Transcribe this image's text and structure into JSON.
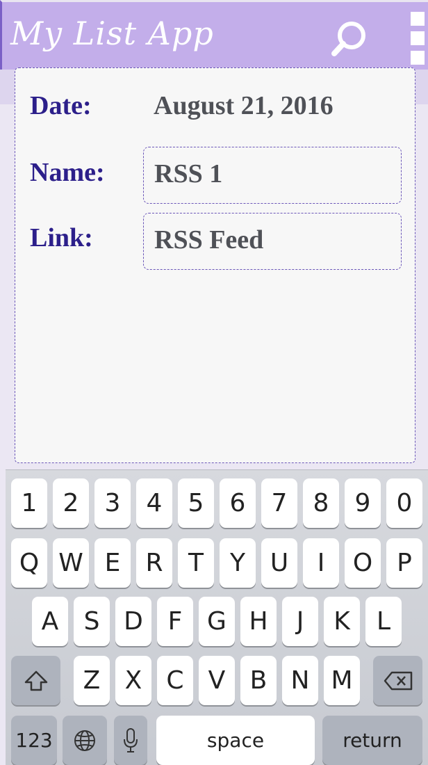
{
  "app": {
    "title": "My List App"
  },
  "form": {
    "date_label": "Date:",
    "date_value": "August 21, 2016",
    "name_label": "Name:",
    "name_value": "RSS 1",
    "link_label": "Link:",
    "link_value": "RSS Feed"
  },
  "keyboard": {
    "row1": [
      "1",
      "2",
      "3",
      "4",
      "5",
      "6",
      "7",
      "8",
      "9",
      "0"
    ],
    "row2": [
      "Q",
      "W",
      "E",
      "R",
      "T",
      "Y",
      "U",
      "I",
      "O",
      "P"
    ],
    "row3": [
      "A",
      "S",
      "D",
      "F",
      "G",
      "H",
      "J",
      "K",
      "L"
    ],
    "row4": [
      "Z",
      "X",
      "C",
      "V",
      "B",
      "N",
      "M"
    ],
    "numbers_key": "123",
    "space_key": "space",
    "return_key": "return"
  },
  "colors": {
    "app_bar": "#c3aeea",
    "label_text": "#2c1f8a",
    "value_text": "#4f5157",
    "card_border": "#6a55b8"
  },
  "icons": {
    "search": "search-icon",
    "menu": "overflow-menu-icon",
    "shift": "shift-icon",
    "delete": "backspace-icon",
    "globe": "globe-icon",
    "mic": "microphone-icon"
  }
}
